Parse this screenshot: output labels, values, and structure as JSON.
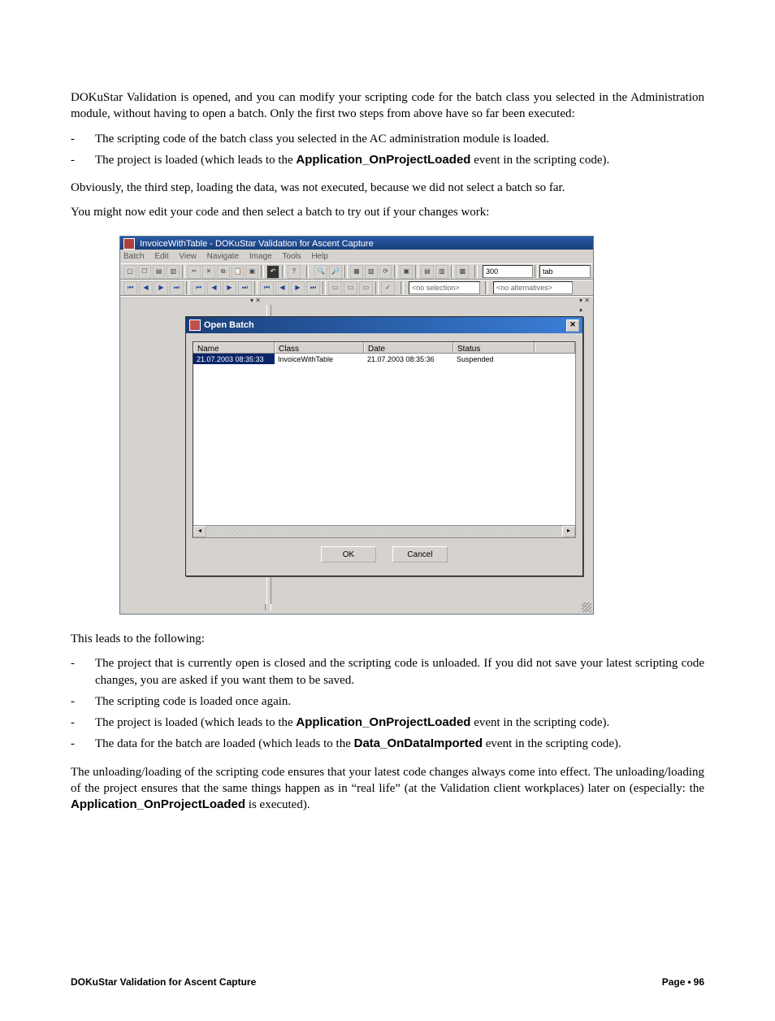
{
  "para1": "DOKuStar Validation is opened, and you can modify your scripting code for the batch class you selected in the Administration module, without having to open a batch. Only the first two steps from above have so far been executed:",
  "bullets1": [
    "The scripting code of the batch class you selected in the AC administration module is loaded.",
    {
      "pre": "The project is loaded (which leads to the ",
      "b": "Application_OnProjectLoaded",
      "post": " event in the scripting code)."
    }
  ],
  "para2": "Obviously, the third step, loading the data, was not executed, because we did not select a batch so far.",
  "para3": "You might now edit your code and then select a batch to try out if your changes work:",
  "app": {
    "title": "InvoiceWithTable - DOKuStar Validation for Ascent Capture",
    "menus": [
      "Batch",
      "Edit",
      "View",
      "Navigate",
      "Image",
      "Tools",
      "Help"
    ],
    "zoomField": "300",
    "selField": "<no selection>",
    "altField": "<no alternatives>",
    "tabField": "tab",
    "dialog": {
      "title": "Open Batch",
      "headers": [
        "Name",
        "Class",
        "Date",
        "Status",
        ""
      ],
      "row": {
        "name": "21.07.2003 08:35:33",
        "class": "InvoiceWithTable",
        "date": "21.07.2003 08:35:36",
        "status": "Suspended"
      },
      "ok": "OK",
      "cancel": "Cancel"
    }
  },
  "para4": "This leads to the following:",
  "bullets2": [
    "The project that is currently open is closed and the scripting code is unloaded. If you did not save your latest scripting code changes, you are asked if you want them to be saved.",
    "The scripting code is loaded once again.",
    {
      "pre": "The project is loaded (which leads to the ",
      "b": "Application_OnProjectLoaded",
      "post": " event in the scripting code)."
    },
    {
      "pre": "The data for the batch are loaded (which leads to the ",
      "b": "Data_OnDataImported",
      "post": " event in the scripting code)."
    }
  ],
  "para5": {
    "pre": "The unloading/loading of the scripting code ensures that your latest code changes always come into effect. The unloading/loading of the project ensures that the same things happen as in “real life” (at the Validation client workplaces) later on (especially: the ",
    "b": "Application_OnProjectLoaded",
    "post": " is executed)."
  },
  "footer": {
    "left": "DOKuStar Validation for Ascent Capture",
    "rightPre": "Page",
    "rightNum": "96"
  }
}
